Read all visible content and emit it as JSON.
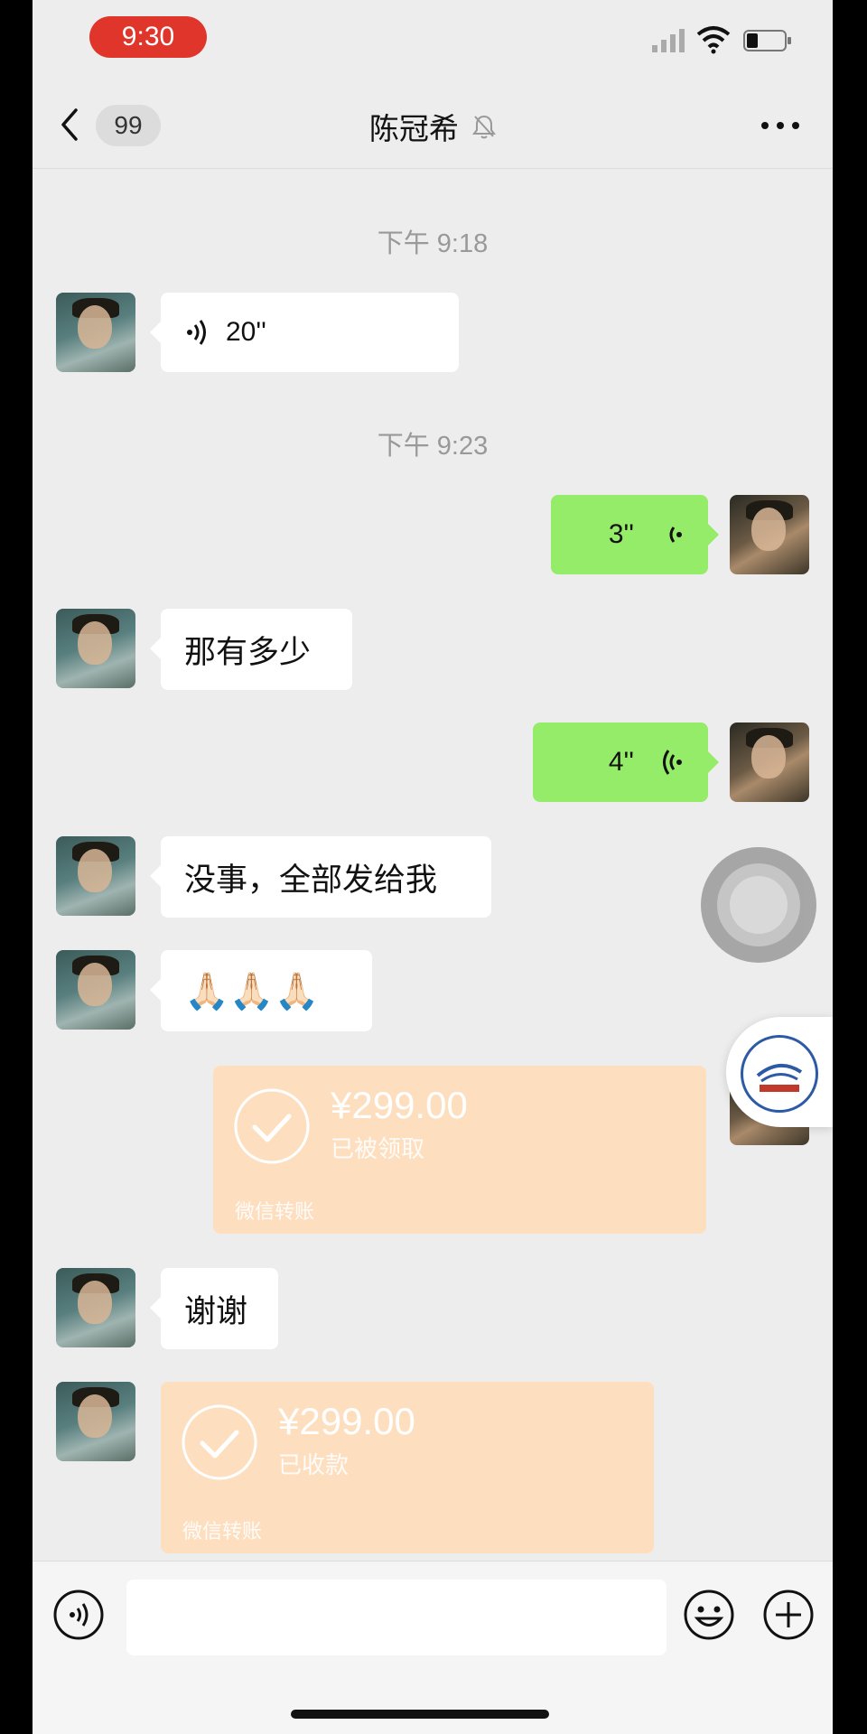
{
  "status_bar": {
    "time": "9:30"
  },
  "nav": {
    "unread_count": "99",
    "title": "陈冠希"
  },
  "messages": [
    {
      "type": "timestamp",
      "text": "下午 9:18"
    },
    {
      "type": "voice",
      "side": "left",
      "duration": "20''"
    },
    {
      "type": "timestamp",
      "text": "下午 9:23"
    },
    {
      "type": "voice",
      "side": "right",
      "duration": "3''"
    },
    {
      "type": "text",
      "side": "left",
      "text": "那有多少"
    },
    {
      "type": "voice",
      "side": "right",
      "duration": "4''"
    },
    {
      "type": "text",
      "side": "left",
      "text": "没事，全部发给我"
    },
    {
      "type": "emoji",
      "side": "left",
      "text": "🙏🏻🙏🏻🙏🏻",
      "count": 3
    },
    {
      "type": "transfer",
      "side": "right",
      "amount": "¥299.00",
      "status": "已被领取",
      "label": "微信转账"
    },
    {
      "type": "text",
      "side": "left",
      "text": "谢谢"
    },
    {
      "type": "transfer",
      "side": "left",
      "amount": "¥299.00",
      "status": "已收款",
      "label": "微信转账"
    }
  ],
  "icons": {
    "back": "chevron-left-icon",
    "mute": "bell-off-icon",
    "more": "more-dots-icon",
    "voice": "voice-wave-icon",
    "emoji": "smiley-icon",
    "plus": "plus-circle-icon",
    "transfer_check": "check-circle-icon"
  },
  "colors": {
    "background": "#ededed",
    "bubble_self": "#95ec69",
    "bubble_other": "#ffffff",
    "transfer_received": "#fddfc0",
    "time_pill": "#e0352b"
  }
}
